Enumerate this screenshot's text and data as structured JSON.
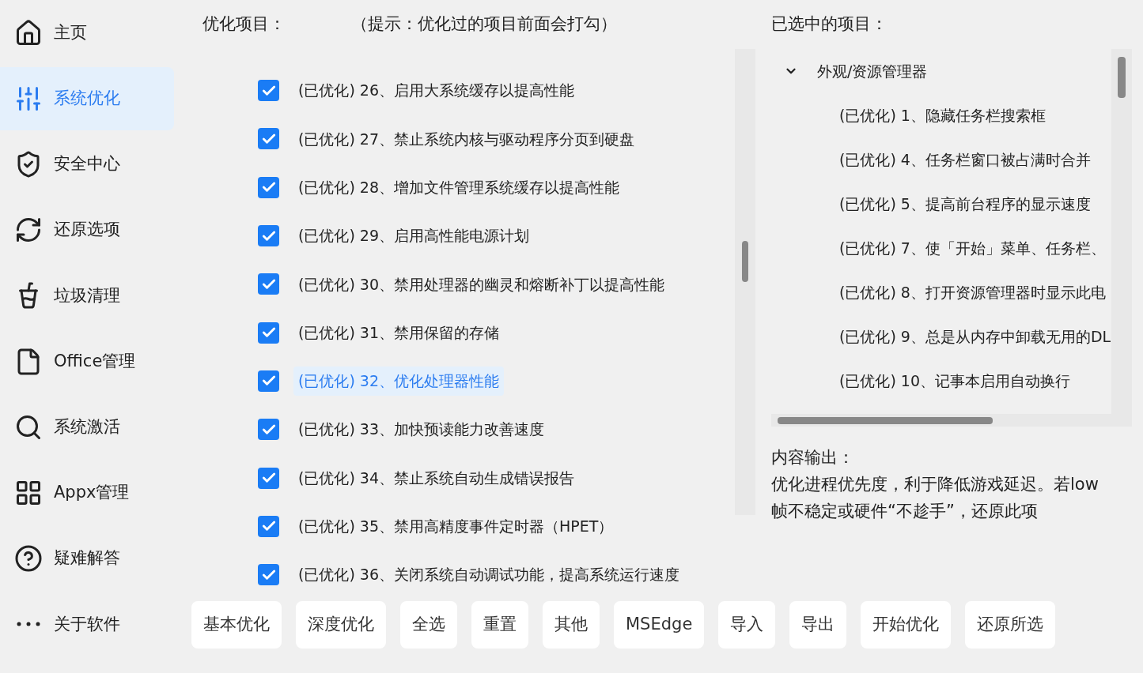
{
  "sidebar": {
    "items": [
      {
        "label": "主页",
        "selected": false
      },
      {
        "label": "系统优化",
        "selected": true
      },
      {
        "label": "安全中心",
        "selected": false
      },
      {
        "label": "还原选项",
        "selected": false
      },
      {
        "label": "垃圾清理",
        "selected": false
      },
      {
        "label": "Office管理",
        "selected": false
      },
      {
        "label": "系统激活",
        "selected": false
      },
      {
        "label": "Appx管理",
        "selected": false
      },
      {
        "label": "疑难解答",
        "selected": false
      },
      {
        "label": "关于软件",
        "selected": false
      }
    ]
  },
  "optimize": {
    "title": "优化项目：",
    "hint": "（提示：优化过的项目前面会打勾）",
    "items": [
      {
        "label": "(已优化) 26、启用大系统缓存以提高性能",
        "checked": true,
        "selected": false
      },
      {
        "label": "(已优化) 27、禁止系统内核与驱动程序分页到硬盘",
        "checked": true,
        "selected": false
      },
      {
        "label": "(已优化) 28、增加文件管理系统缓存以提高性能",
        "checked": true,
        "selected": false
      },
      {
        "label": "(已优化) 29、启用高性能电源计划",
        "checked": true,
        "selected": false
      },
      {
        "label": "(已优化) 30、禁用处理器的幽灵和熔断补丁以提高性能",
        "checked": true,
        "selected": false
      },
      {
        "label": "(已优化) 31、禁用保留的存储",
        "checked": true,
        "selected": false
      },
      {
        "label": "(已优化) 32、优化处理器性能",
        "checked": true,
        "selected": true
      },
      {
        "label": "(已优化) 33、加快预读能力改善速度",
        "checked": true,
        "selected": false
      },
      {
        "label": "(已优化) 34、禁止系统自动生成错误报告",
        "checked": true,
        "selected": false
      },
      {
        "label": "(已优化) 35、禁用高精度事件定时器（HPET）",
        "checked": true,
        "selected": false
      },
      {
        "label": "(已优化) 36、关闭系统自动调试功能，提高系统运行速度",
        "checked": true,
        "selected": false
      }
    ]
  },
  "selected_panel": {
    "title": "已选中的项目：",
    "tree": [
      {
        "label": "外观/资源管理器",
        "expanded": true,
        "children": [
          {
            "label": "(已优化) 1、隐藏任务栏搜索框"
          },
          {
            "label": "(已优化) 4、任务栏窗口被占满时合并"
          },
          {
            "label": "(已优化) 5、提高前台程序的显示速度"
          },
          {
            "label": "(已优化) 7、使「开始」菜单、任务栏、"
          },
          {
            "label": "(已优化) 8、打开资源管理器时显示此电"
          },
          {
            "label": "(已优化) 9、总是从内存中卸载无用的DL"
          },
          {
            "label": "(已优化) 10、记事本启用自动换行"
          }
        ]
      }
    ]
  },
  "output": {
    "title": "内容输出：",
    "text": "优化进程优先度，利于降低游戏延迟。若low帧不稳定或硬件“不趁手”，还原此项"
  },
  "buttons": [
    "基本优化",
    "深度优化",
    "全选",
    "重置",
    "其他",
    "MSEdge",
    "导入",
    "导出",
    "开始优化",
    "还原所选"
  ]
}
